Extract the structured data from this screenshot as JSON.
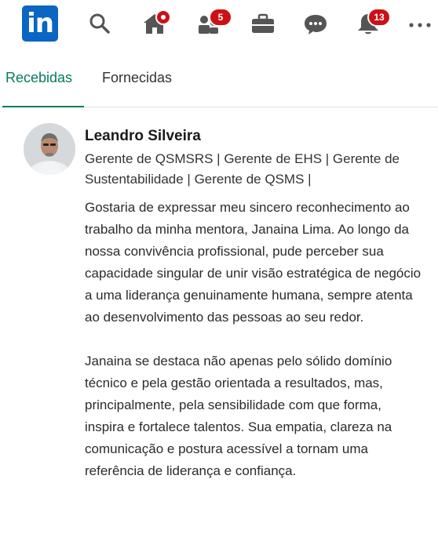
{
  "nav": {
    "logo_text": "in",
    "icons": [
      {
        "name": "search-icon"
      },
      {
        "name": "home-icon",
        "badge": "dot"
      },
      {
        "name": "my-network-icon",
        "badge": "5"
      },
      {
        "name": "jobs-icon"
      },
      {
        "name": "messaging-icon"
      },
      {
        "name": "notifications-icon",
        "badge": "13"
      },
      {
        "name": "more-icon"
      }
    ],
    "brand_color": "#0a66c2",
    "badge_color": "#cc1016"
  },
  "tabs": {
    "received": "Recebidas",
    "given": "Fornecidas",
    "active_color": "#037c5b"
  },
  "recommendation": {
    "name": "Leandro Silveira",
    "headline": "Gerente de QSMSRS | Gerente de EHS | Gerente de Sustentabilidade | Gerente de QSMS |",
    "paragraphs": [
      "Gostaria de expressar meu sincero reconhecimento ao trabalho da minha mentora, Janaina Lima. Ao longo da nossa convivência profissional, pude perceber sua capacidade singular de unir visão estratégica de negócio a uma liderança genuinamente humana, sempre atenta ao desenvolvimento das pessoas ao seu redor.",
      "Janaina se destaca não apenas pelo sólido domínio técnico e pela gestão orientada a resultados, mas, principalmente, pela sensibilidade com que forma, inspira e fortalece talentos. Sua empatia, clareza na comunicação e postura acessível a tornam uma referência de liderança e confiança."
    ]
  }
}
